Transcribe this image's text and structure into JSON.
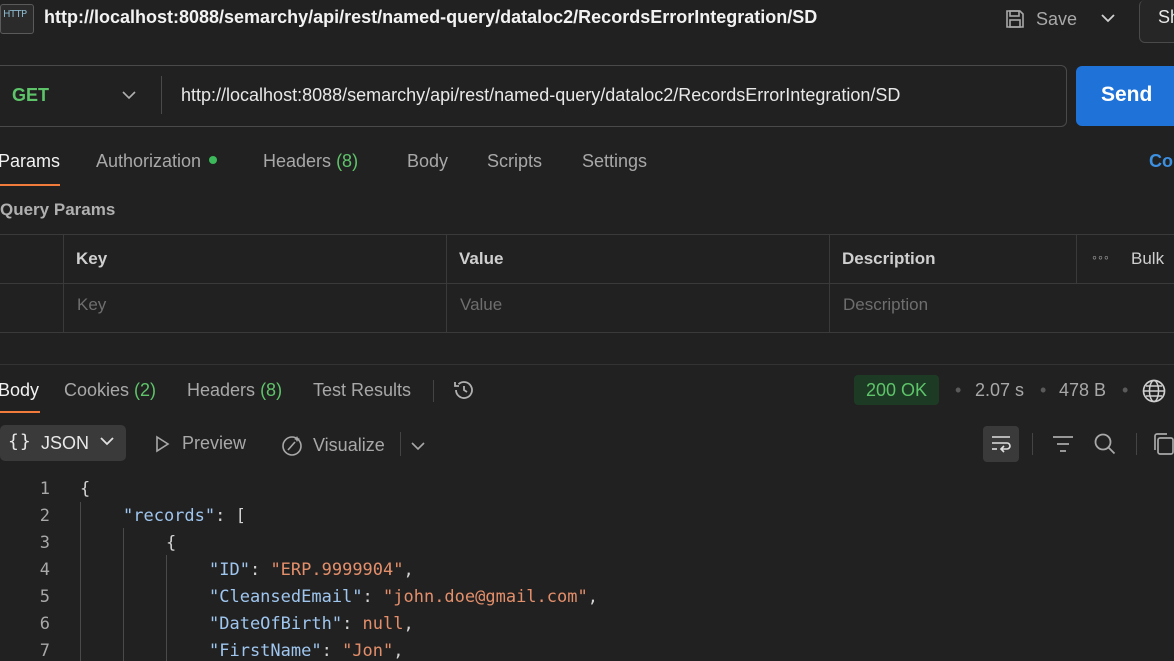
{
  "titlebar": {
    "icon_text": "HTTP",
    "url": "http://localhost:8088/semarchy/api/rest/named-query/dataloc2/RecordsErrorIntegration/SD",
    "save_label": "Save",
    "share_label": "Sh"
  },
  "request": {
    "method": "GET",
    "url": "http://localhost:8088/semarchy/api/rest/named-query/dataloc2/RecordsErrorIntegration/SD",
    "send_label": "Send"
  },
  "request_tabs": {
    "params": "Params",
    "authorization": "Authorization",
    "headers": "Headers",
    "headers_count": "(8)",
    "body": "Body",
    "scripts": "Scripts",
    "settings": "Settings",
    "cookies": "Co"
  },
  "query_params": {
    "title": "Query Params",
    "columns": [
      "Key",
      "Value",
      "Description"
    ],
    "placeholders": [
      "Key",
      "Value",
      "Description"
    ],
    "bulk_edit": "Bulk"
  },
  "response_tabs": {
    "body": "Body",
    "cookies": "Cookies",
    "cookies_count": "(2)",
    "headers": "Headers",
    "headers_count": "(8)",
    "test_results": "Test Results"
  },
  "response_meta": {
    "status": "200 OK",
    "time": "2.07 s",
    "size": "478 B"
  },
  "body_toolbar": {
    "format": "JSON",
    "preview": "Preview",
    "visualize": "Visualize"
  },
  "code": {
    "line_numbers": [
      "1",
      "2",
      "3",
      "4",
      "5",
      "6",
      "7"
    ],
    "l1": "{",
    "l2_key": "\"records\"",
    "l2_rest": ": [",
    "l3": "{",
    "l4_key": "\"ID\"",
    "l4_val": "\"ERP.9999904\"",
    "l5_key": "\"CleansedEmail\"",
    "l5_val": "\"john.doe@gmail.com\"",
    "l6_key": "\"DateOfBirth\"",
    "l6_val": "null",
    "l7_key": "\"FirstName\"",
    "l7_val": "\"Jon\""
  },
  "colors": {
    "accent_send": "#1f72d8",
    "tab_underline": "#f07b3a",
    "success": "#5ec46a",
    "json_key": "#9fc6ef",
    "json_string": "#e48f6b"
  }
}
